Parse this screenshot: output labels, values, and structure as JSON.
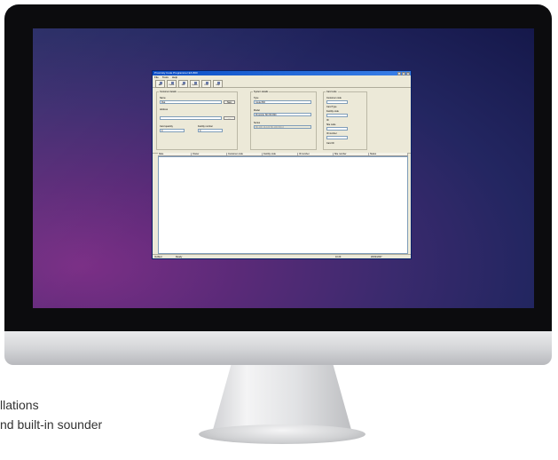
{
  "caption": {
    "line1": "llations",
    "line2": "nd built-in sounder"
  },
  "app": {
    "title": "Proximity Code Programmer EX-800",
    "window_buttons": [
      "_",
      "□",
      "X"
    ],
    "menu": [
      "File",
      "Tools",
      "Help"
    ],
    "toolbar": [
      "Add",
      "Delete",
      "Edit",
      "Update",
      "Print",
      "Help"
    ],
    "customer_group": {
      "label": "Customer details",
      "name_label": "Name",
      "name_value": "Flat",
      "new_button": "New",
      "address_label": "Address",
      "address_button": "...",
      "count_label": "Card quantity",
      "count_value": "0",
      "code_label": "Facility number",
      "code_value": "0"
    },
    "system_group": {
      "label": "System details",
      "type_label": "Type",
      "type_value": "Code 800",
      "model_label": "Model",
      "model_value": "Proximity 80 (ID) 800",
      "series_label": "Series",
      "series_value": "80-100 10-100 80-100 800-0"
    },
    "card_group": {
      "label": "Card code",
      "items": [
        {
          "label": "Customer code",
          "value": ""
        },
        {
          "label": "Card Type",
          "value": ""
        },
        {
          "label": "Facility code",
          "value": ""
        },
        {
          "label": "ID",
          "value": ""
        },
        {
          "label": "Site code",
          "value": ""
        },
        {
          "label": "ID number",
          "value": ""
        },
        {
          "label": "Card ID",
          "value": ""
        }
      ]
    },
    "table_headers": [
      "Date",
      "Owner",
      "Customer code",
      "Facility code",
      "ID number",
      "Site number",
      "Status"
    ],
    "status": {
      "left": "Verified",
      "mid": "Ready",
      "right1": "10:20",
      "right2": "26/04/2007"
    }
  }
}
